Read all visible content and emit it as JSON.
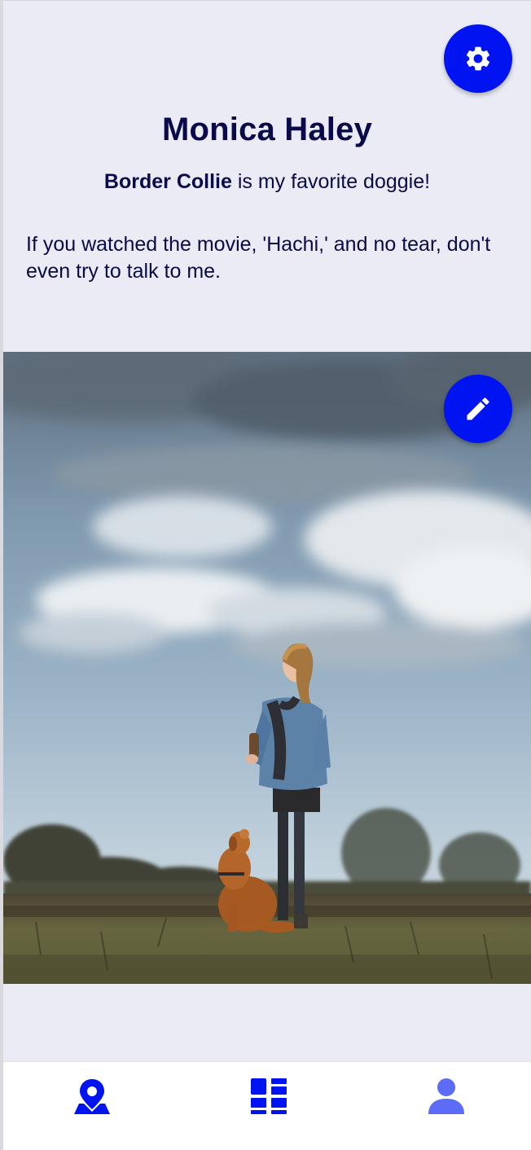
{
  "profile": {
    "name": "Monica Haley",
    "favorite_breed": "Border Collie",
    "favorite_suffix": " is my favorite doggie!",
    "bio": "If you watched the movie, 'Hachi,' and no tear, don't even try to talk to me."
  },
  "buttons": {
    "settings_icon": "gear-icon",
    "edit_icon": "pencil-icon"
  },
  "photo": {
    "subject": "woman-and-dog"
  },
  "nav": {
    "items": [
      {
        "icon": "map-pin-icon",
        "active": true
      },
      {
        "icon": "grid-icon",
        "active": false
      },
      {
        "icon": "person-icon",
        "active": false
      }
    ]
  },
  "colors": {
    "accent": "#0014f2",
    "text": "#0a0a4a",
    "background": "#ebebf6",
    "nav_inactive": "#5c6cf6"
  }
}
